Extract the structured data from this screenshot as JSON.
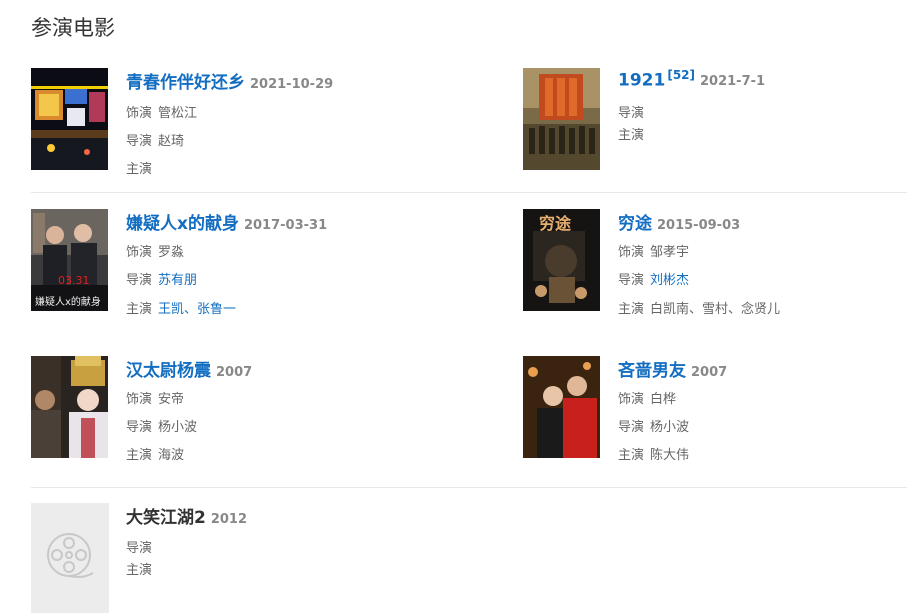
{
  "section_title": "参演电影",
  "films": [
    {
      "title": "青春作伴好还乡",
      "year": "2021-10-29",
      "role_label": "饰演",
      "role": "管松江",
      "director_label": "导演",
      "director": "赵琦",
      "cast_label": "主演"
    },
    {
      "title": "1921",
      "cite": "[52]",
      "year": "2021-7-1",
      "director_label": "导演",
      "cast_label": "主演"
    },
    {
      "title": "嫌疑人x的献身",
      "year": "2017-03-31",
      "role_label": "饰演",
      "role": "罗淼",
      "director_label": "导演",
      "director": "苏有朋",
      "cast_label": "主演",
      "cast_1": "王凯",
      "cast_sep": "、",
      "cast_2": "张鲁一",
      "poster_text": "嫌疑人x的献身",
      "poster_date": "03.31"
    },
    {
      "title": "穷途",
      "year": "2015-09-03",
      "role_label": "饰演",
      "role": "邹孝宇",
      "director_label": "导演",
      "director": "刘彬杰",
      "cast_label": "主演",
      "cast": "白凯南、雪村、念贤儿",
      "poster_text": "穷途"
    },
    {
      "title": "汉太尉杨震",
      "year": "2007",
      "role_label": "饰演",
      "role": "安帝",
      "director_label": "导演",
      "director": "杨小波",
      "cast_label": "主演",
      "cast": "海波"
    },
    {
      "title": "吝啬男友",
      "year": "2007",
      "role_label": "饰演",
      "role": "白桦",
      "director_label": "导演",
      "director": "杨小波",
      "cast_label": "主演",
      "cast": "陈大伟"
    },
    {
      "title": "大笑江湖2",
      "year": "2012",
      "director_label": "导演",
      "cast_label": "主演"
    }
  ]
}
